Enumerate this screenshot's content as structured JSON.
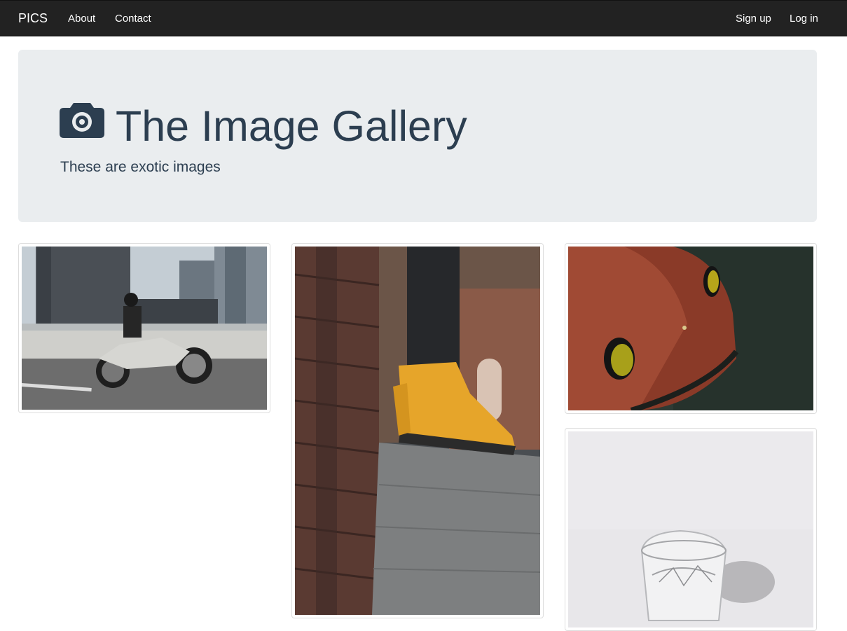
{
  "navbar": {
    "brand": "PICS",
    "links": [
      "About",
      "Contact"
    ],
    "right_links": [
      "Sign up",
      "Log in"
    ]
  },
  "jumbotron": {
    "icon": "camera-icon",
    "title": "The Image Gallery",
    "subtitle": "These are exotic images"
  },
  "gallery": {
    "images": [
      {
        "name": "motorcycle-image"
      },
      {
        "name": "yellow-sneaker-image"
      },
      {
        "name": "red-car-image"
      },
      {
        "name": "water-glass-image"
      }
    ]
  },
  "colors": {
    "navbar_bg": "#222222",
    "jumbotron_bg": "#eaedef",
    "heading_text": "#2c3e50"
  }
}
